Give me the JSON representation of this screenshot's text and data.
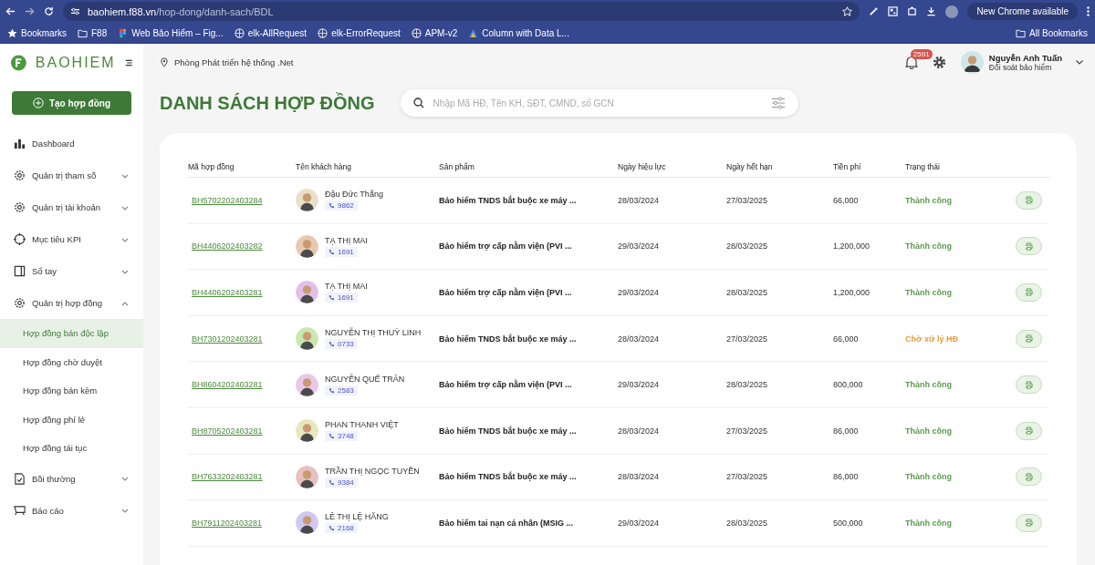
{
  "browser": {
    "url_host": "baohiem.f88.vn",
    "url_path": "/hop-dong/danh-sach/BDL",
    "update_button": "New Chrome available",
    "bookmarks": [
      {
        "label": "Bookmarks",
        "kind": "star"
      },
      {
        "label": "F88",
        "kind": "folder"
      },
      {
        "label": "Web Bảo Hiểm – Fig...",
        "kind": "figma"
      },
      {
        "label": "elk-AllRequest",
        "kind": "elk"
      },
      {
        "label": "elk-ErrorRequest",
        "kind": "elk"
      },
      {
        "label": "APM-v2",
        "kind": "elk"
      },
      {
        "label": "Column with Data L...",
        "kind": "triangle"
      }
    ],
    "all_bookmarks": "All Bookmarks"
  },
  "logo": "BAOHIEM",
  "create_button": "Tạo hợp đồng",
  "department": "Phòng Phát triển hệ thống .Net",
  "notifications": {
    "count": "2591"
  },
  "user": {
    "name": "Nguyễn Anh Tuấn",
    "role": "Đối soát bảo hiểm"
  },
  "sidebar": {
    "items": [
      {
        "label": "Dashboard",
        "kind": "chart"
      },
      {
        "label": "Quản trị tham số",
        "kind": "gear",
        "expanded": false
      },
      {
        "label": "Quản trị tài khoản",
        "kind": "gear",
        "expanded": false
      },
      {
        "label": "Mục tiêu KPI",
        "kind": "target",
        "expanded": false
      },
      {
        "label": "Sổ tay",
        "kind": "book",
        "expanded": false
      },
      {
        "label": "Quản trị hợp đồng",
        "kind": "gear",
        "expanded": true,
        "children": [
          {
            "label": "Hợp đồng bán độc lập",
            "selected": true
          },
          {
            "label": "Hợp đồng chờ duyệt",
            "selected": false
          },
          {
            "label": "Hợp đồng bán kèm",
            "selected": false
          },
          {
            "label": "Hợp đồng phí lẻ",
            "selected": false
          },
          {
            "label": "Hợp đồng tái tục",
            "selected": false
          }
        ]
      },
      {
        "label": "Bồi thường",
        "kind": "doc",
        "expanded": false
      },
      {
        "label": "Báo cáo",
        "kind": "cart",
        "expanded": false
      }
    ]
  },
  "page_title": "DANH SÁCH HỢP ĐỒNG",
  "search": {
    "placeholder": "Nhập Mã HĐ, Tên KH, SĐT, CMND, số GCN"
  },
  "table": {
    "columns": [
      "Mã hợp đồng",
      "Tên khách hàng",
      "Sản phẩm",
      "Ngày hiệu lực",
      "Ngày hết hạn",
      "Tiền phí",
      "Trạng thái"
    ],
    "rows": [
      {
        "code": "BH5702202403284",
        "name": "Đậu Đức Thắng",
        "phone": "9862",
        "color": "#e8e0c8",
        "product": "Bảo hiểm TNDS bắt buộc xe máy ...",
        "start": "28/03/2024",
        "end": "27/03/2025",
        "fee": "66,000",
        "status": "Thành công",
        "kind": "success"
      },
      {
        "code": "BH4406202403282",
        "name": "TẠ THỊ MAI",
        "phone": "1691",
        "color": "#e8c8b0",
        "product": "Bảo hiểm trợ cấp nằm viện (PVI ...",
        "start": "29/03/2024",
        "end": "28/03/2025",
        "fee": "1,200,000",
        "status": "Thành công",
        "kind": "success"
      },
      {
        "code": "BH4406202403281",
        "name": "TẠ THỊ MAI",
        "phone": "1691",
        "color": "#e0c0e8",
        "product": "Bảo hiểm trợ cấp nằm viện (PVI ...",
        "start": "29/03/2024",
        "end": "28/03/2025",
        "fee": "1,200,000",
        "status": "Thành công",
        "kind": "success"
      },
      {
        "code": "BH7301202403281",
        "name": "NGUYỄN THỊ THUỲ LINH",
        "phone": "0733",
        "color": "#c8e8b0",
        "product": "Bảo hiểm TNDS bắt buộc xe máy ...",
        "start": "28/03/2024",
        "end": "27/03/2025",
        "fee": "66,000",
        "status": "Chờ xử lý HĐ",
        "kind": "pending"
      },
      {
        "code": "BH8604202403281",
        "name": "NGUYỄN QUẾ TRÂN",
        "phone": "2583",
        "color": "#e8c8e8",
        "product": "Bảo hiểm trợ cấp nằm viện (PVI ...",
        "start": "29/03/2024",
        "end": "28/03/2025",
        "fee": "800,000",
        "status": "Thành công",
        "kind": "success"
      },
      {
        "code": "BH8705202403281",
        "name": "PHAN THANH VIỆT",
        "phone": "3748",
        "color": "#e8e8c0",
        "product": "Bảo hiểm TNDS bắt buộc xe máy ...",
        "start": "28/03/2024",
        "end": "27/03/2025",
        "fee": "86,000",
        "status": "Thành công",
        "kind": "success"
      },
      {
        "code": "BH7633202403281",
        "name": "TRẦN THỊ NGỌC TUYỀN",
        "phone": "9384",
        "color": "#e8c0c0",
        "product": "Bảo hiểm TNDS bắt buộc xe máy ...",
        "start": "28/03/2024",
        "end": "27/03/2025",
        "fee": "86,000",
        "status": "Thành công",
        "kind": "success"
      },
      {
        "code": "BH7911202403281",
        "name": "LÊ THỊ LỆ HẰNG",
        "phone": "2168",
        "color": "#d0c8f0",
        "product": "Bảo hiểm tai nạn cá nhân (MSIG ...",
        "start": "29/03/2024",
        "end": "28/03/2025",
        "fee": "500,000",
        "status": "Thành công",
        "kind": "success"
      }
    ]
  }
}
